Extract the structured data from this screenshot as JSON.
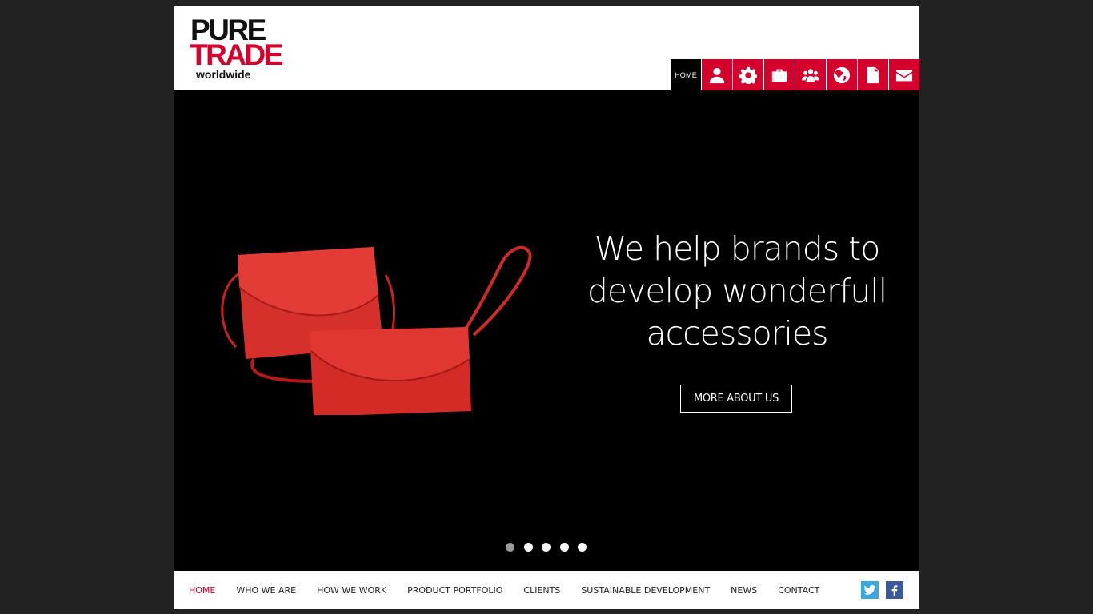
{
  "logo": {
    "line1": "PURE",
    "line2": "TRADE",
    "line3": "worldwide"
  },
  "icon_nav": {
    "home_label": "HOME",
    "icons": [
      "user-icon",
      "gear-icon",
      "briefcase-icon",
      "group-icon",
      "globe-icon",
      "document-icon",
      "envelope-icon"
    ]
  },
  "hero": {
    "headline": "We help brands to develop wonderfull accessories",
    "cta_label": "MORE ABOUT US",
    "slide_count": 5,
    "active_slide": 1
  },
  "bottom_nav": {
    "items": [
      {
        "label": "HOME",
        "active": true
      },
      {
        "label": "WHO WE ARE",
        "active": false
      },
      {
        "label": "HOW WE WORK",
        "active": false
      },
      {
        "label": "PRODUCT PORTFOLIO",
        "active": false
      },
      {
        "label": "CLIENTS",
        "active": false
      },
      {
        "label": "SUSTAINABLE DEVELOPMENT",
        "active": false
      },
      {
        "label": "NEWS",
        "active": false
      },
      {
        "label": "CONTACT",
        "active": false
      }
    ]
  },
  "social": [
    "twitter-icon",
    "facebook-icon"
  ],
  "colors": {
    "brand_red": "#d5002b",
    "background": "#222222",
    "hero_bg": "#000000",
    "twitter": "#3aa7e0",
    "facebook": "#3b5998"
  }
}
